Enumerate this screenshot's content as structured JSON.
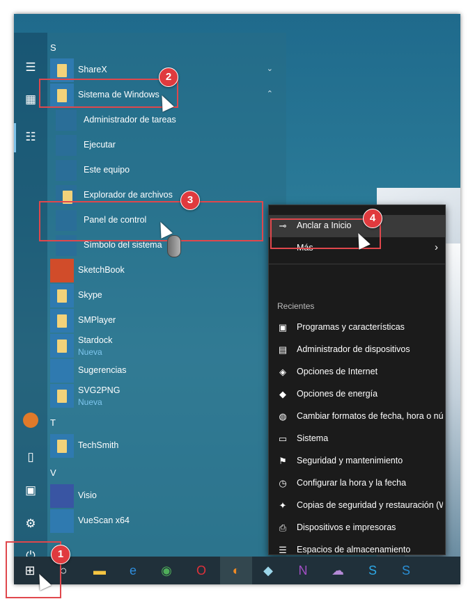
{
  "rail": {
    "icons": [
      "hamburger-icon",
      "tiles-icon",
      "list-icon",
      "user-avatar-icon",
      "document-icon",
      "pictures-icon",
      "settings-icon",
      "power-icon"
    ]
  },
  "menu": {
    "letters": {
      "s": "S",
      "t": "T",
      "v": "V"
    },
    "sharex": "ShareX",
    "sistema": "Sistema de Windows",
    "sub": {
      "admin": "Administrador de tareas",
      "ejecutar": "Ejecutar",
      "equipo": "Este equipo",
      "explorador": "Explorador de archivos",
      "panel": "Panel de control",
      "simbolo": "Símbolo del sistema"
    },
    "sketchbook": "SketchBook",
    "skype": "Skype",
    "smplayer": "SMPlayer",
    "stardock": "Stardock",
    "stardock_badge": "Nueva",
    "sugerencias": "Sugerencias",
    "svg2png": "SVG2PNG",
    "svg2png_badge": "Nueva",
    "techsmith": "TechSmith",
    "visio": "Visio",
    "vuescan": "VueScan x64"
  },
  "context_menu": {
    "pin": "Anclar a Inicio",
    "more": "Más",
    "recent_header": "Recientes",
    "recent": [
      "Programas y características",
      "Administrador de dispositivos",
      "Opciones de Internet",
      "Opciones de energía",
      "Cambiar formatos de fecha, hora o nú...",
      "Sistema",
      "Seguridad y mantenimiento",
      "Configurar la hora y la fecha",
      "Copias de seguridad y restauración (Wi...",
      "Dispositivos e impresoras",
      "Espacios de almacenamiento"
    ]
  },
  "badges": {
    "b1": "1",
    "b2": "2",
    "b3": "3",
    "b4": "4"
  },
  "taskbar": {
    "apps": [
      "windows-start",
      "cortana",
      "file-explorer",
      "edge",
      "chrome",
      "opera",
      "firefox",
      "winscp",
      "onenote",
      "cloud",
      "skype",
      "snagit"
    ]
  }
}
